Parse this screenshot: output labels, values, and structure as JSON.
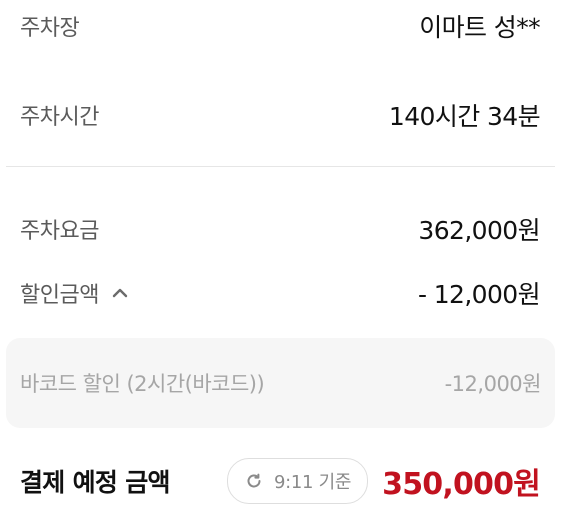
{
  "rows": {
    "parking_lot": {
      "label": "주차장",
      "value": "이마트 성**"
    },
    "parking_time": {
      "label": "주차시간",
      "value": "140시간 34분"
    },
    "parking_fee": {
      "label": "주차요금",
      "value": "362,000원"
    },
    "discount_amount": {
      "label": "할인금액",
      "value": "- 12,000원",
      "chevron_icon": "chevron-up-icon"
    }
  },
  "discount_detail": {
    "label": "바코드 할인 (2시간(바코드))",
    "value": "-12,000원"
  },
  "payment": {
    "title": "결제 예정 금액",
    "refresh_label": "9:11  기준",
    "refresh_icon": "refresh-icon",
    "amount": "350,000원",
    "amount_color": "#c1121f"
  }
}
